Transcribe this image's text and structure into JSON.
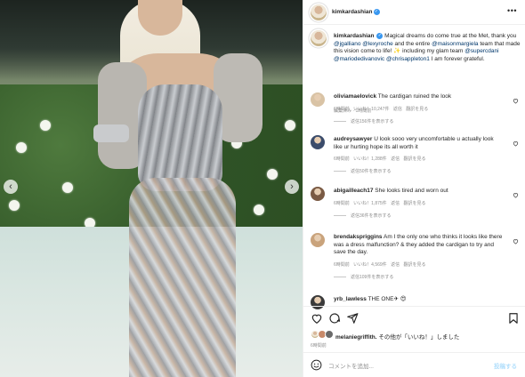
{
  "post": {
    "author": "kimkardashian",
    "more_label": "•••",
    "caption": {
      "author": "kimkardashian",
      "text_parts": [
        {
          "t": "Magical dreams do come true at the Met, thank you ",
          "m": false
        },
        {
          "t": "@jgalliano",
          "m": true
        },
        {
          "t": " ",
          "m": false
        },
        {
          "t": "@lexyroche",
          "m": true
        },
        {
          "t": " and the entire ",
          "m": false
        },
        {
          "t": "@maisonmargiela",
          "m": true
        },
        {
          "t": " team that made this vision come to life! ✨ including my glam team ",
          "m": false
        },
        {
          "t": "@supercdani",
          "m": true
        },
        {
          "t": " ",
          "m": false
        },
        {
          "t": "@mariodedivanovic",
          "m": true
        },
        {
          "t": " ",
          "m": false
        },
        {
          "t": "@chrisappleton1",
          "m": true
        },
        {
          "t": " I am forever grateful.",
          "m": false
        }
      ],
      "meta": "編集済み · 1時間前"
    }
  },
  "comments": [
    {
      "user": "oliviamaelovick",
      "text": "The cardigan ruined the look",
      "meta": "6時間前 いいね！10,247件 返信 翻訳を見る",
      "replies": "返信156件を表示する"
    },
    {
      "user": "audreysawyer",
      "text": "U look sooo very uncomfortable u actually look like ur hurting hope its all worth it",
      "meta": "6時間前 いいね！1,288件 返信 翻訳を見る",
      "replies": "返信50件を表示する"
    },
    {
      "user": "abigailleach17",
      "text": "She looks tired and worn out",
      "meta": "6時間前 いいね！1,875件 返信 翻訳を見る",
      "replies": "返信36件を表示する"
    },
    {
      "user": "brendakspriggins",
      "text": "Am I the only one who thinks it looks like there was a dress malfunction? & they added the cardigan to try and save the day.",
      "meta": "6時間前 いいね！4,569件 返信 翻訳を見る",
      "replies": "返信109件を表示する"
    },
    {
      "user": "yrb_lawless",
      "text": "THE ONE✈ 😍",
      "meta": "",
      "replies": ""
    }
  ],
  "likes": {
    "user": "melaniegriffith.",
    "text": "その他が「いいね！」しました",
    "time": "6時間前"
  },
  "add_comment": {
    "placeholder": "コメントを追加...",
    "post_label": "投稿する"
  },
  "nav": {
    "prev": "‹",
    "next": "›"
  }
}
